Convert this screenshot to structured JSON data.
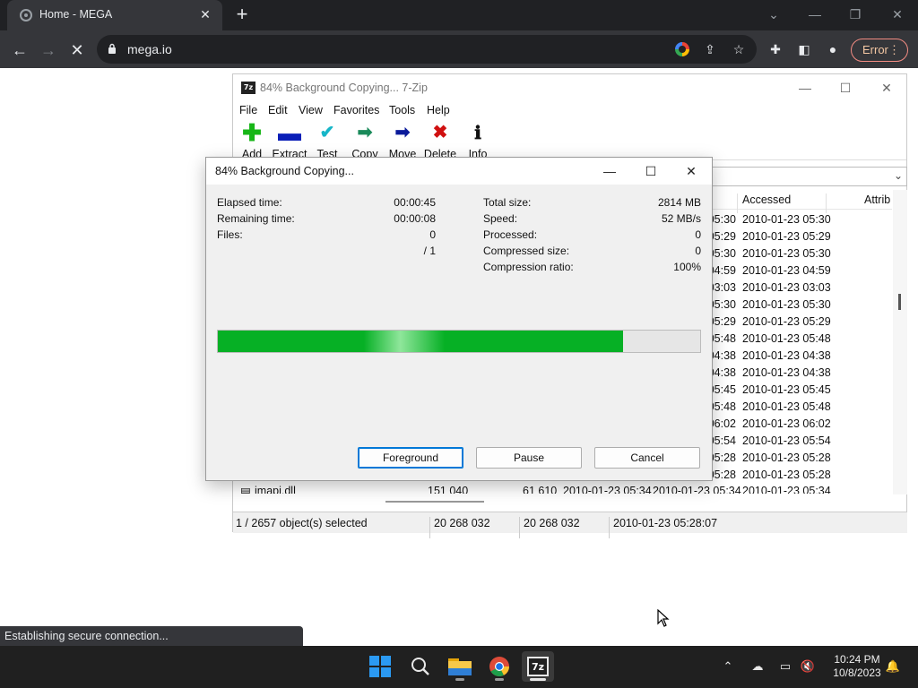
{
  "browser": {
    "tab_title": "Home - MEGA",
    "url": "mega.io",
    "error_label": "Error",
    "status_text": "Establishing secure connection..."
  },
  "zip": {
    "window_title": "84% Background Copying... 7-Zip",
    "menu": [
      "File",
      "Edit",
      "View",
      "Favorites",
      "Tools",
      "Help"
    ],
    "tools": [
      {
        "label": "Add",
        "icon": "add-icon",
        "color": "#17b617"
      },
      {
        "label": "Extract",
        "icon": "extract-icon",
        "color": "#0a1fb8"
      },
      {
        "label": "Test",
        "icon": "test-icon",
        "color": "#17b6c8"
      },
      {
        "label": "Copy",
        "icon": "copy-icon",
        "color": "#1a8a5a"
      },
      {
        "label": "Move",
        "icon": "move-icon",
        "color": "#0a1a9a"
      },
      {
        "label": "Delete",
        "icon": "delete-icon",
        "color": "#d01010"
      },
      {
        "label": "Info",
        "icon": "info-icon",
        "color": "#d0b000"
      }
    ],
    "columns": {
      "accessed": "Accessed",
      "attrib": "Attrib"
    },
    "rows": [
      {
        "modified": "05:30",
        "accessed": "2010-01-23 05:30"
      },
      {
        "modified": "05:29",
        "accessed": "2010-01-23 05:29"
      },
      {
        "modified": "05:30",
        "accessed": "2010-01-23 05:30"
      },
      {
        "modified": "04:59",
        "accessed": "2010-01-23 04:59"
      },
      {
        "modified": "03:03",
        "accessed": "2010-01-23 03:03"
      },
      {
        "modified": "05:30",
        "accessed": "2010-01-23 05:30"
      },
      {
        "modified": "05:29",
        "accessed": "2010-01-23 05:29"
      },
      {
        "modified": "05:48",
        "accessed": "2010-01-23 05:48"
      },
      {
        "modified": "04:38",
        "accessed": "2010-01-23 04:38"
      },
      {
        "modified": "04:38",
        "accessed": "2010-01-23 04:38"
      },
      {
        "modified": "05:45",
        "accessed": "2010-01-23 05:45"
      },
      {
        "modified": "05:48",
        "accessed": "2010-01-23 05:48"
      },
      {
        "modified": "06:02",
        "accessed": "2010-01-23 06:02"
      },
      {
        "modified": "05:54",
        "accessed": "2010-01-23 05:54"
      },
      {
        "modified": "05:28",
        "accessed": "2010-01-23 05:28"
      },
      {
        "modified": "05:28",
        "accessed": "2010-01-23 05:28"
      }
    ],
    "partial_row": {
      "name": "imapi.dll",
      "size": "151 040",
      "packed": "61 610",
      "modified": "2010-01-23 05:34",
      "created": "2010-01-23 05:34",
      "accessed": "2010-01-23 05:34"
    },
    "status": {
      "selected": "1 / 2657 object(s) selected",
      "size": "20 268 032",
      "packed": "20 268 032",
      "date": "2010-01-23 05:28:07"
    }
  },
  "dialog": {
    "title": "84% Background Copying...",
    "elapsed_label": "Elapsed time:",
    "elapsed_value": "00:00:45",
    "remaining_label": "Remaining time:",
    "remaining_value": "00:00:08",
    "files_label": "Files:",
    "files_value": "0",
    "files_total": "/ 1",
    "total_size_label": "Total size:",
    "total_size_value": "2814 MB",
    "speed_label": "Speed:",
    "speed_value": "52 MB/s",
    "processed_label": "Processed:",
    "processed_value": "0",
    "compressed_label": "Compressed size:",
    "compressed_value": "0",
    "ratio_label": "Compression ratio:",
    "ratio_value": "100%",
    "progress": 0.84,
    "buttons": {
      "foreground": "Foreground",
      "pause": "Pause",
      "cancel": "Cancel"
    }
  },
  "taskbar": {
    "apps": [
      "start-icon",
      "search-icon",
      "file-explorer-icon",
      "chrome-icon",
      "7zip-icon"
    ],
    "time": "10:24 PM",
    "date": "10/8/2023"
  }
}
